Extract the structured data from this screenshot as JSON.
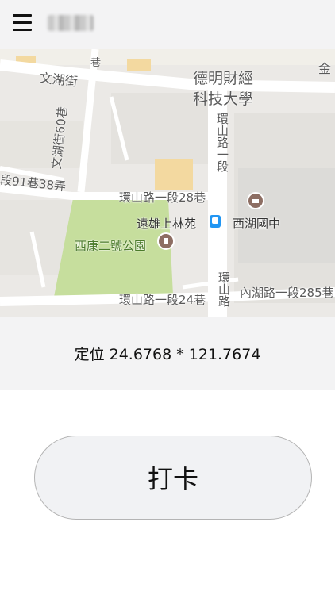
{
  "header": {
    "menu_icon": "hamburger-menu-icon",
    "title": "■ ■■"
  },
  "map": {
    "labels": {
      "wenhu_st": "文湖街",
      "university": "德明財經",
      "university2": "科技大學",
      "wenhu_60": "文湖街60巷",
      "huanshan_sec1": "環山路一段",
      "lane91": "段91巷38弄",
      "huanshan_28": "環山路一段28巷",
      "yuanxiong": "遠雄上林苑",
      "xihu_junior": "西湖國中",
      "xikang_park": "西康二號公園",
      "huanshan_24": "環山路一段24巷",
      "neihu_285": "內湖路一段285巷",
      "huanshan_road": "環山路",
      "jin": "金",
      "lane_mark": "巷"
    },
    "icons": {
      "school": "school-pin-icon",
      "metro": "metro-station-icon",
      "park": "park-pin-icon"
    }
  },
  "location": {
    "text": "定位 24.6768 * 121.7674"
  },
  "actions": {
    "punch_label": "打卡"
  }
}
